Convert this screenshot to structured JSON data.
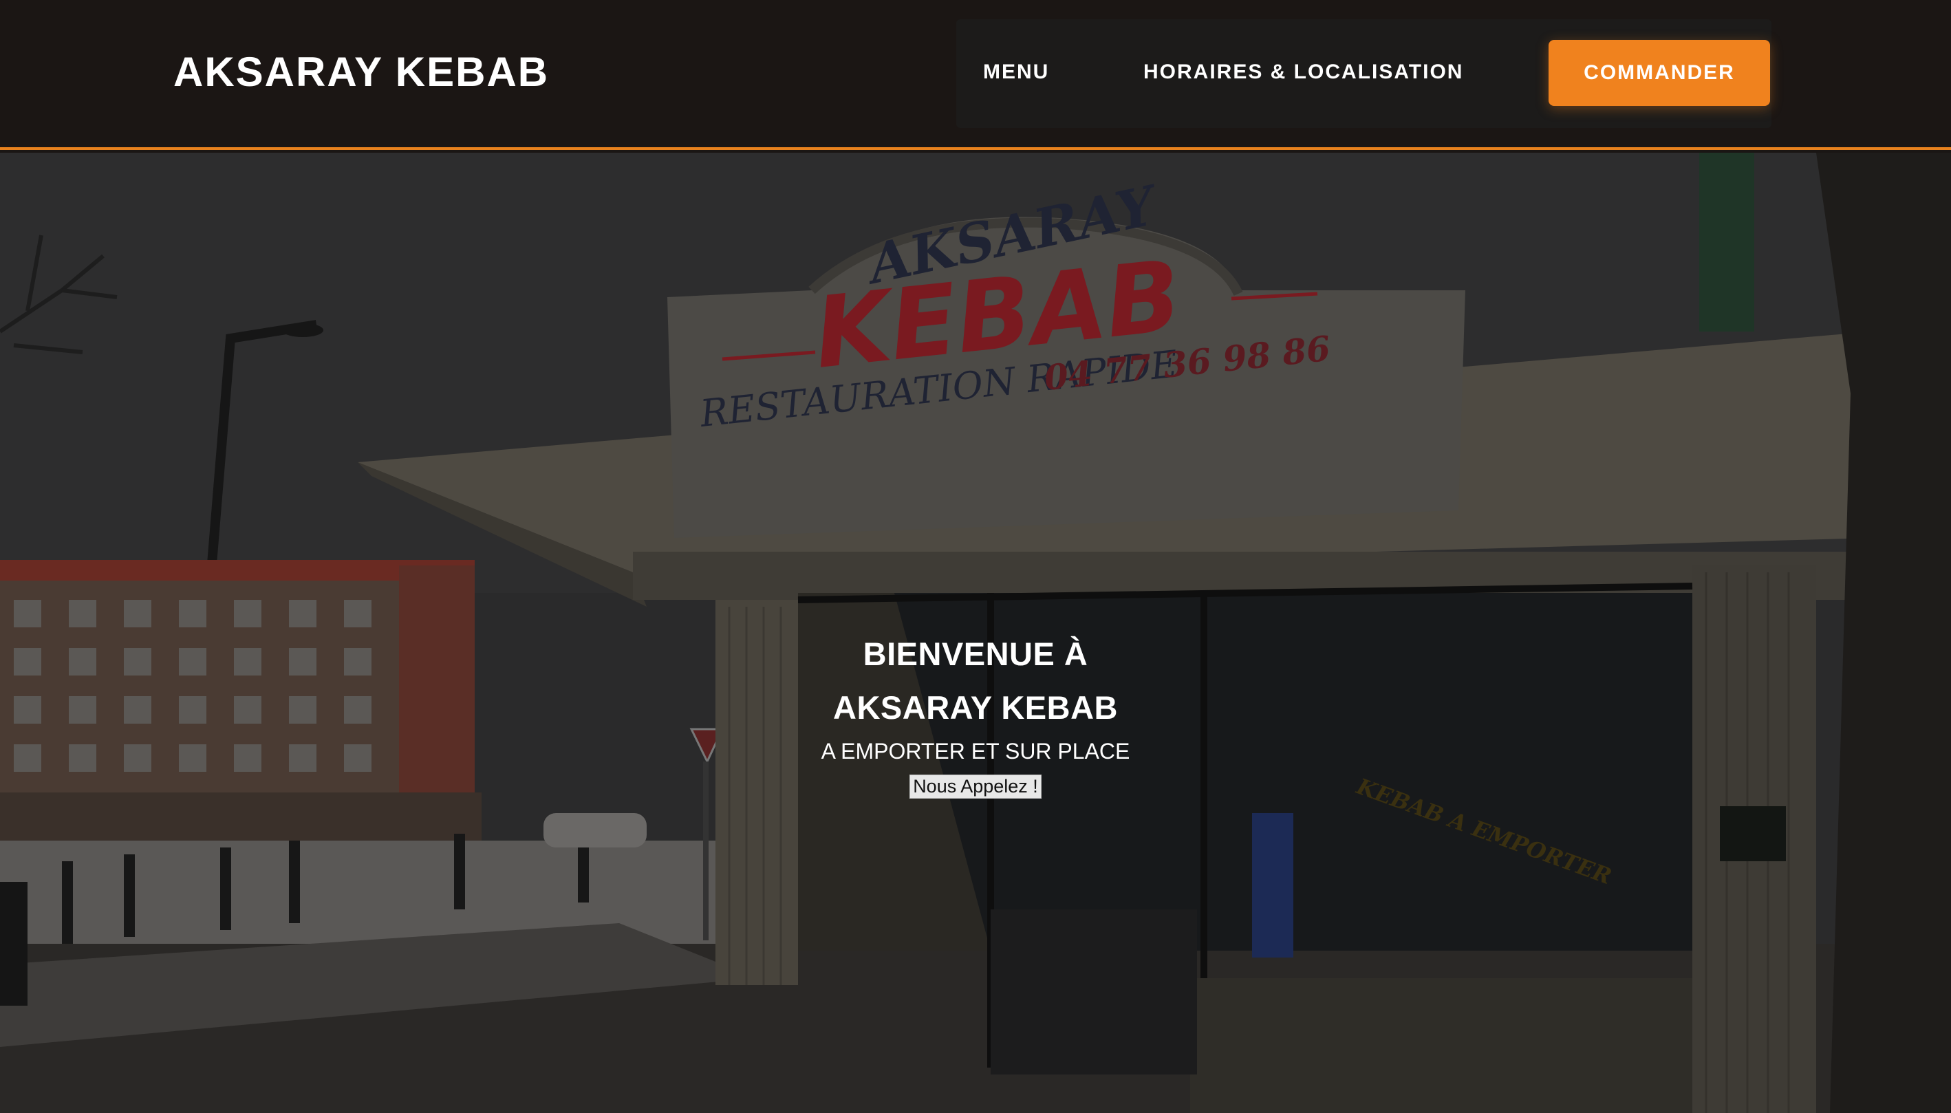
{
  "header": {
    "brand": "AKSARAY KEBAB",
    "nav": [
      {
        "label": "MENU"
      },
      {
        "label": "HORAIRES & LOCALISATION"
      }
    ],
    "cta_label": "COMMANDER"
  },
  "hero": {
    "title_line1": "BIENVENUE À",
    "title_line2": "AKSARAY KEBAB",
    "subtitle": "A EMPORTER ET SUR PLACE",
    "call_label": "Nous Appelez !",
    "sign": {
      "top": "AKSARAY",
      "main": "KEBAB",
      "bottom": "RESTAURATION RAPIDE",
      "phone": "04 77 36 98 86"
    },
    "window_text": "KEBAB A EMPORTER"
  },
  "colors": {
    "accent": "#f0821e",
    "header_bg": "#1b1614",
    "sign_red": "#b3202a"
  }
}
